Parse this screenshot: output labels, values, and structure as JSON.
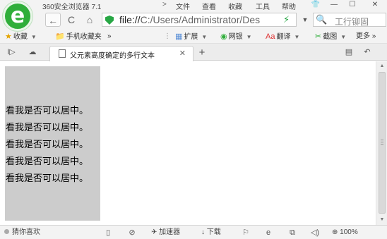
{
  "window": {
    "app_title": "360安全浏览器 7.1",
    "title_nav": ">",
    "menu": [
      "文件",
      "查看",
      "收藏",
      "工具",
      "帮助"
    ],
    "controls": {
      "skin": "👕",
      "minimize": "—",
      "maximize": "☐",
      "close": "✕"
    }
  },
  "address": {
    "back": "←",
    "refresh": "C",
    "home": "⌂",
    "url_scheme": "file://",
    "url_path": "C:/Users/Administrator/Des",
    "dropdown": "▼",
    "search_placeholder": "工行铆固"
  },
  "bookmarks": {
    "favorites": "收藏",
    "mobile_favorites": "手机收藏夹",
    "more_arrows": "»",
    "extensions": "扩展",
    "netbank": "网银",
    "translate": "翻译",
    "screenshot": "截图",
    "more": "更多",
    "more_tail": "»"
  },
  "tabs": {
    "items": [
      {
        "title": "父元素高度确定的多行文本"
      }
    ],
    "new_tab": "+"
  },
  "page": {
    "lines": [
      "看我是否可以居中。",
      "看我是否可以居中。",
      "看我是否可以居中。",
      "看我是否可以居中。",
      "看我是否可以居中。"
    ]
  },
  "statusbar": {
    "guess": "猜你喜欢",
    "accelerator": "加速器",
    "download": "下载",
    "zoom": "100%"
  },
  "icons": {
    "logo": "360-logo-icon",
    "back": "back-arrow-icon",
    "shield": "shield-icon",
    "bolt": "lightning-icon"
  },
  "colors": {
    "brand_green": "#2fae3a",
    "box_gray": "#cccccc"
  }
}
